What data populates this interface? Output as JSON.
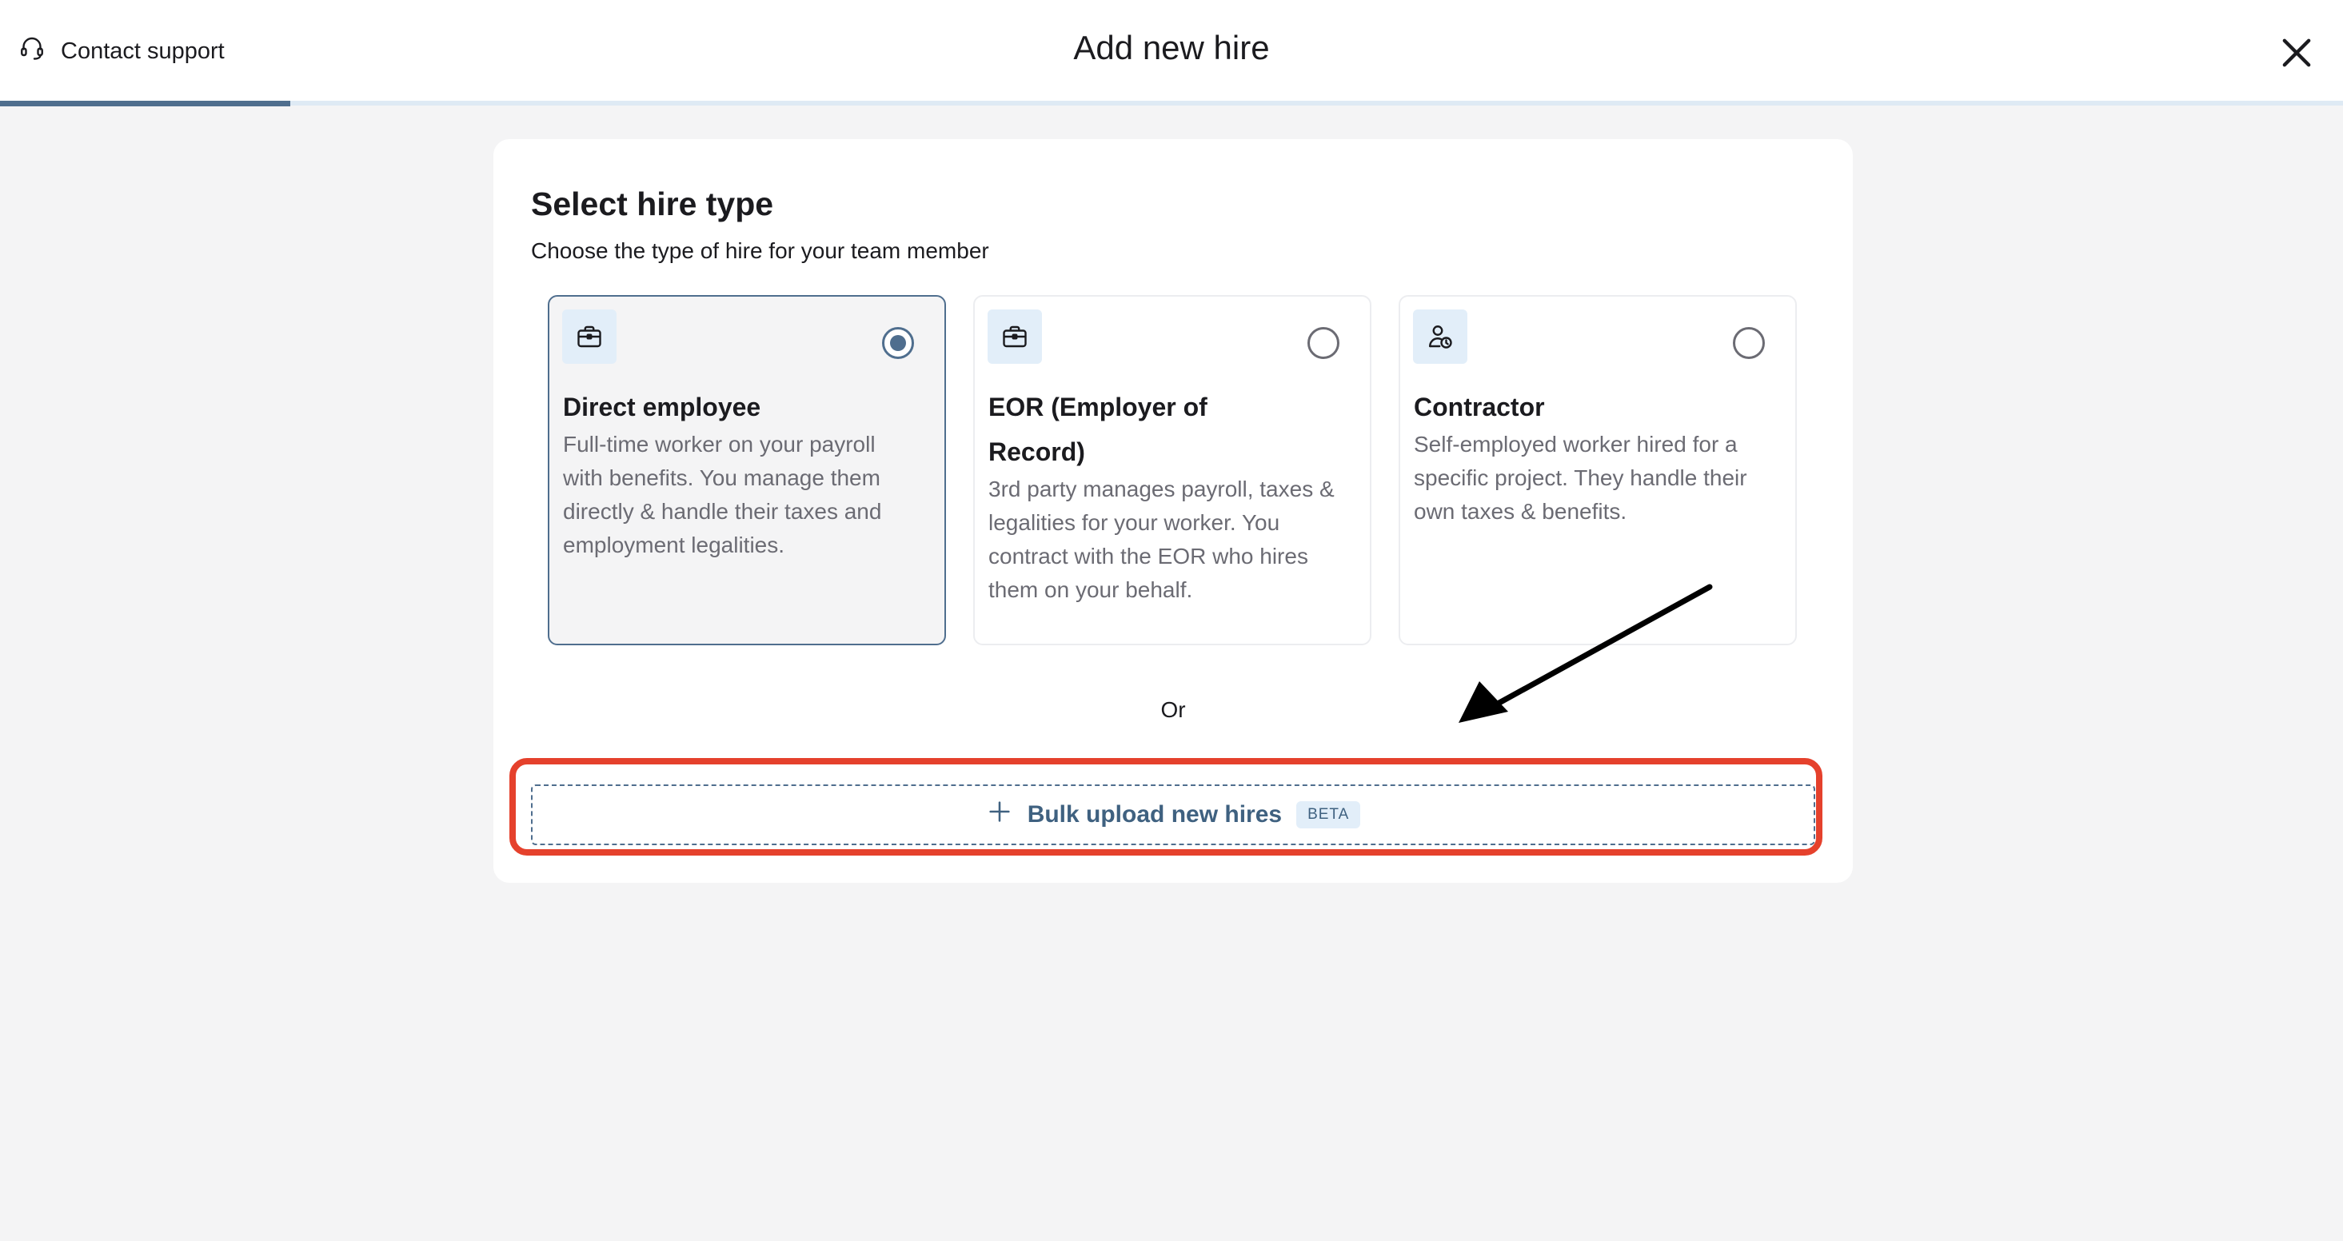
{
  "header": {
    "support_label": "Contact support",
    "title": "Add new hire",
    "progress_fraction": 0.124
  },
  "card": {
    "title": "Select hire type",
    "subtitle": "Choose the type of hire for your team member",
    "options": [
      {
        "title": "Direct employee",
        "description": "Full-time worker on your payroll with benefits. You manage them directly & handle their taxes and employment legalities.",
        "icon": "briefcase-icon",
        "selected": true
      },
      {
        "title": "EOR (Employer of Record)",
        "description": "3rd party manages payroll, taxes & legalities for your worker. You contract with the EOR who hires them on your behalf.",
        "icon": "briefcase-icon",
        "selected": false
      },
      {
        "title": "Contractor",
        "description": "Self-employed worker hired for a specific project. They handle their own taxes & benefits.",
        "icon": "person-clock-icon",
        "selected": false
      }
    ],
    "or_label": "Or",
    "bulk_label": "Bulk upload new hires",
    "bulk_badge": "BETA"
  },
  "colors": {
    "accent": "#4f6e8e",
    "highlight": "#e5412c",
    "icon_bg": "#e2eef9"
  }
}
